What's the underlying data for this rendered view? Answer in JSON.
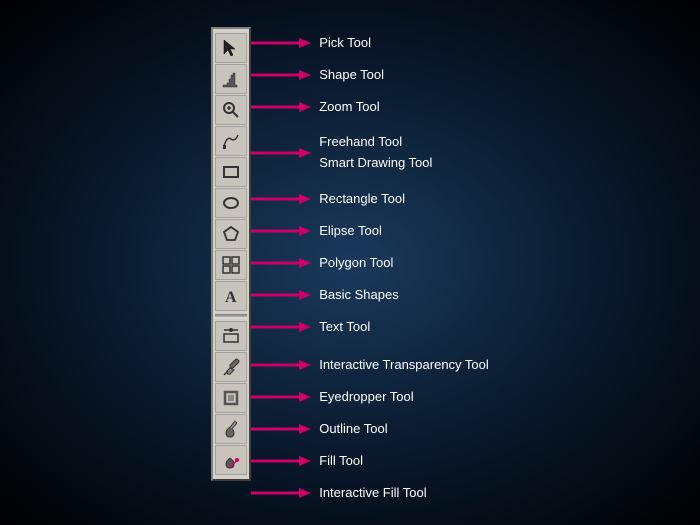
{
  "tools": [
    {
      "id": "pick",
      "label": "Pick Tool",
      "icon": "pick"
    },
    {
      "id": "shape",
      "label": "Shape Tool",
      "icon": "shape"
    },
    {
      "id": "zoom",
      "label": "Zoom Tool",
      "icon": "zoom"
    },
    {
      "id": "freehand-smart",
      "label": "Freehand Tool\nSmart Drawing Tool",
      "icon": "freehand",
      "double": true
    },
    {
      "id": "rectangle",
      "label": "Rectangle Tool",
      "icon": "rectangle"
    },
    {
      "id": "ellipse",
      "label": "Elipse Tool",
      "icon": "ellipse"
    },
    {
      "id": "polygon",
      "label": "Polygon Tool",
      "icon": "polygon"
    },
    {
      "id": "basic-shapes",
      "label": "Basic Shapes",
      "icon": "basicshapes"
    },
    {
      "id": "text",
      "label": "Text Tool",
      "icon": "text"
    },
    {
      "id": "separator",
      "label": "",
      "icon": "separator"
    },
    {
      "id": "transparency",
      "label": "Interactive Transparency Tool",
      "icon": "transparency"
    },
    {
      "id": "eyedropper",
      "label": "Eyedropper Tool",
      "icon": "eyedropper"
    },
    {
      "id": "outline",
      "label": "Outline Tool",
      "icon": "outline"
    },
    {
      "id": "fill",
      "label": "Fill Tool",
      "icon": "fill"
    },
    {
      "id": "ifill",
      "label": "Interactive Fill Tool",
      "icon": "ifill"
    }
  ],
  "colors": {
    "arrow": "#cc0066",
    "toolbar_bg": "#d4d0c8",
    "label": "#ffffff"
  }
}
